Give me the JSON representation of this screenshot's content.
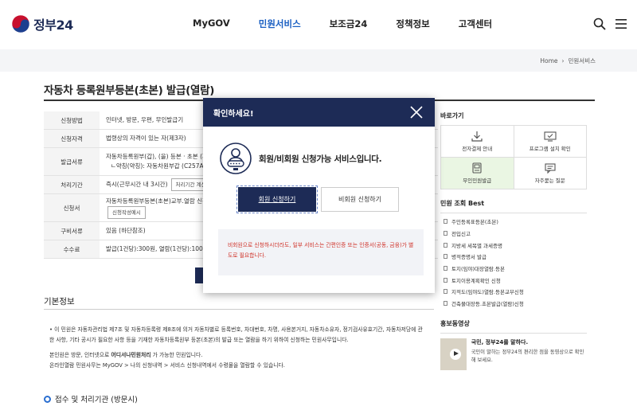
{
  "header": {
    "logo_text": "정부24",
    "nav": [
      "MyGOV",
      "민원서비스",
      "보조금24",
      "정책정보",
      "고객센터"
    ],
    "active_nav": "민원서비스",
    "icons": [
      "search-icon",
      "menu-icon"
    ]
  },
  "breadcrumb": {
    "home": "Home",
    "current": "민원서비스"
  },
  "page_title": "자동차 등록원부등본(초본) 발급(열람)",
  "info": {
    "rows": [
      {
        "th": "신청방법",
        "td": "인터넷, 방문, 우편, 무인발급기"
      },
      {
        "th": "신청자격",
        "td": "법령상의 자격이 있는 자(제3자)"
      },
      {
        "th": "발급서류",
        "td": "자동차등록원부(갑), (을) 등본 · 초본 (자동",
        "td2": "ㄴ약칭(약칭): 자동차원부갑 (C257A)"
      },
      {
        "th": "처리기간",
        "td": "즉시(근무시간 내 3시간)",
        "btn": "처리기간 계산 방"
      },
      {
        "th": "신청서",
        "td": "자동차등록원부등본(초본)교부.열람 신청서",
        "btn": "신청작성예시"
      },
      {
        "th": "구비서류",
        "td": "있음 (하단참조)"
      },
      {
        "th": "수수료",
        "td": "발급(1건당):300원, 열람(1건당):100원. 인"
      }
    ]
  },
  "basic_info": {
    "title": "기본정보",
    "para1": "• 이 민원은 자동차관리법 제7조 및 자동차등록령 제8조에 의거 자동차별로 등록번호, 차대번호, 차명, 사용본거지, 자동차소유자, 정기검사유효기간, 자동차저당에 관한 사항, 기타 공시가 필요한 사항 등을 기재한 자동차등록원부 등본(초본)의 발급 또는 열람을 하기 위하여 신청하는 민원사무입니다.",
    "para2_a": "본인원은 방문, 인터넷으로 ",
    "para2_b": "어디서나민원처리",
    "para2_c": " 가 가능한 민원입니다.",
    "para3": "온라인열람 민원사무는 MyGOV > 나의 신청내역 > 서비스 신청내역에서 수령물을 열람할 수 있습니다.",
    "sub_title": "접수 및 처리기관 (방문시)"
  },
  "aside": {
    "quick_title": "바로가기",
    "quick_links": [
      {
        "label": "전자결제 안내",
        "icon": "download-icon"
      },
      {
        "label": "프로그램 설치 확인",
        "icon": "monitor-check-icon"
      },
      {
        "label": "무인민원발급",
        "icon": "kiosk-icon"
      },
      {
        "label": "자주묻는 질문",
        "icon": "faq-icon"
      }
    ],
    "best_title": "민원 조회 Best",
    "best_items": [
      "주민등록표등본(초본)",
      "전입신고",
      "지방세 세목별 과세증명",
      "병적증명서 발급",
      "토지(임야)대장열람.등본",
      "토지이용계획확인 신청",
      "지적도(임야도)열람.등본교부신청",
      "건축물대장등.초본발급(열람)신청"
    ],
    "promo_title": "홍보동영상",
    "promo_headline": "국민, 정부24를 말하다.",
    "promo_desc": "국민이 말하는 정부24의 편리한 점을 동영상으로 확인해 보세요."
  },
  "modal": {
    "title": "확인하세요!",
    "message": "회원/비회원 신청가능 서비스입니다.",
    "primary_label": "회원 신청하기",
    "secondary_label": "비회원 신청하기",
    "note": "비회원으로 신청하시더라도, 일부 서비스는 간편인증 또는 인증서(공동, 금융)가 별도로 필요합니다."
  },
  "colors": {
    "navy": "#1d2b56",
    "accent_blue": "#1a5fc2",
    "warning_red": "#d0332a"
  }
}
